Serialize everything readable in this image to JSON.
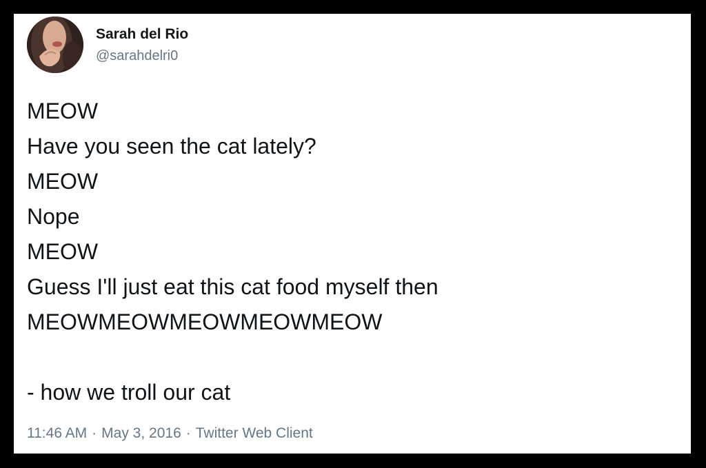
{
  "tweet": {
    "author": {
      "name": "Sarah del Rio",
      "handle": "@sarahdelri0"
    },
    "lines": [
      "MEOW",
      "Have you seen the cat lately?",
      "MEOW",
      "Nope",
      "MEOW",
      "Guess I'll just eat this cat food myself then",
      "MEOWMEOWMEOWMEOWMEOW",
      "",
      "- how we troll our cat"
    ],
    "time": "11:46 AM",
    "separator": "·",
    "date": "May 3, 2016",
    "client": "Twitter Web Client"
  },
  "colors": {
    "frame_border": "#000000",
    "background": "#ffffff",
    "text": "#0f1419",
    "secondary_text": "#657786"
  }
}
